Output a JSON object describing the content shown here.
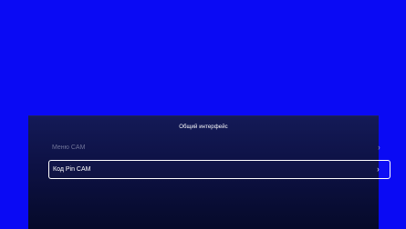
{
  "screen": {
    "background_color": "#0a0af4"
  },
  "dialog": {
    "title": "Общий интерфейс",
    "items": [
      {
        "label": "Меню CAM",
        "chevron": "›",
        "state": "disabled"
      },
      {
        "label": "Код Pin CAM",
        "chevron": "›",
        "state": "selected"
      }
    ]
  }
}
